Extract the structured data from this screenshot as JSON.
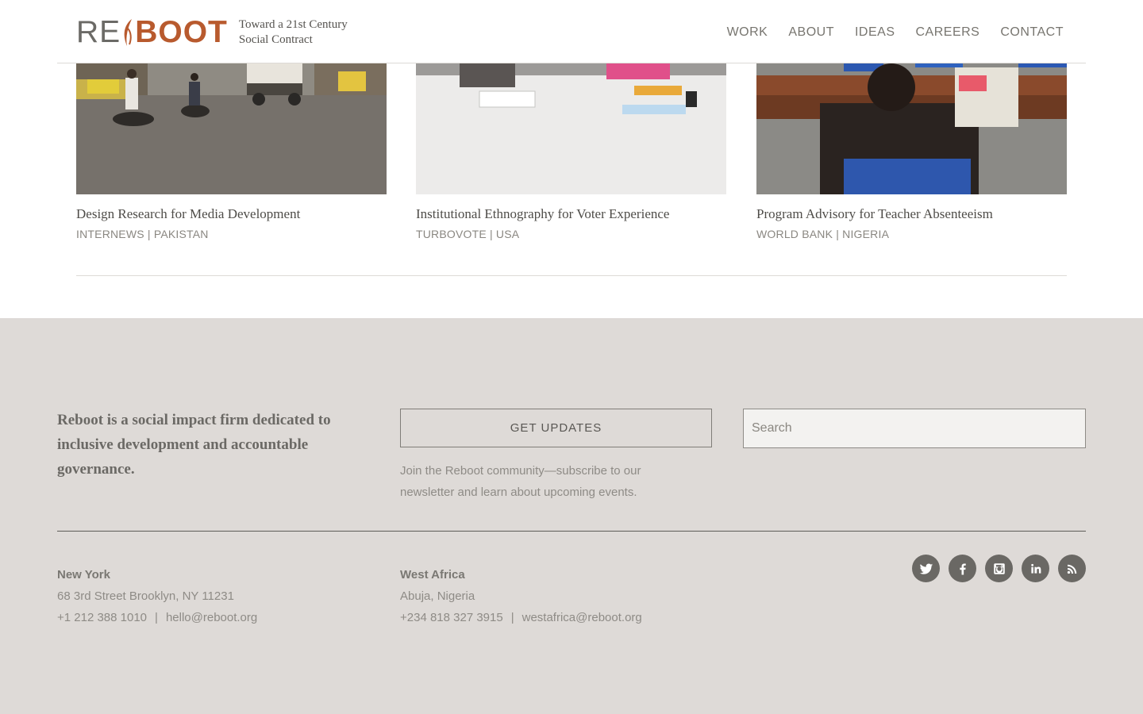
{
  "header": {
    "logo_re": "RE",
    "logo_boot": "BOOT",
    "tagline_line1": "Toward a 21st Century",
    "tagline_line2": "Social Contract",
    "nav": [
      "WORK",
      "ABOUT",
      "IDEAS",
      "CAREERS",
      "CONTACT"
    ]
  },
  "projects": [
    {
      "title": "Design Research for Media Development",
      "meta": "INTERNEWS | PAKISTAN"
    },
    {
      "title": "Institutional Ethnography for Voter Experience",
      "meta": "TURBOVOTE | USA"
    },
    {
      "title": "Program Advisory for Teacher Absenteeism",
      "meta": "WORLD BANK | NIGERIA"
    }
  ],
  "footer": {
    "mission": "Reboot is a social impact firm dedicated to inclusive development and accountable governance.",
    "updates_button": "GET UPDATES",
    "updates_text": "Join the Reboot community—subscribe to our newsletter and learn about upcoming events.",
    "search_placeholder": "Search",
    "offices": [
      {
        "city": "New York",
        "address": "68 3rd Street Brooklyn, NY 11231",
        "phone": "+1 212 388 1010",
        "separator": "|",
        "email": "hello@reboot.org"
      },
      {
        "city": "West Africa",
        "address": "Abuja, Nigeria",
        "phone": "+234 818 327 3915",
        "separator": "|",
        "email": "westafrica@reboot.org"
      }
    ],
    "social_icons": [
      "twitter-icon",
      "facebook-icon",
      "instagram-icon",
      "linkedin-icon",
      "rss-icon"
    ]
  },
  "colors": {
    "brand_orange": "#b85a2e",
    "logo_gray": "#6b6a66",
    "footer_bg": "#dedad7",
    "social_bg": "#6a6864"
  }
}
